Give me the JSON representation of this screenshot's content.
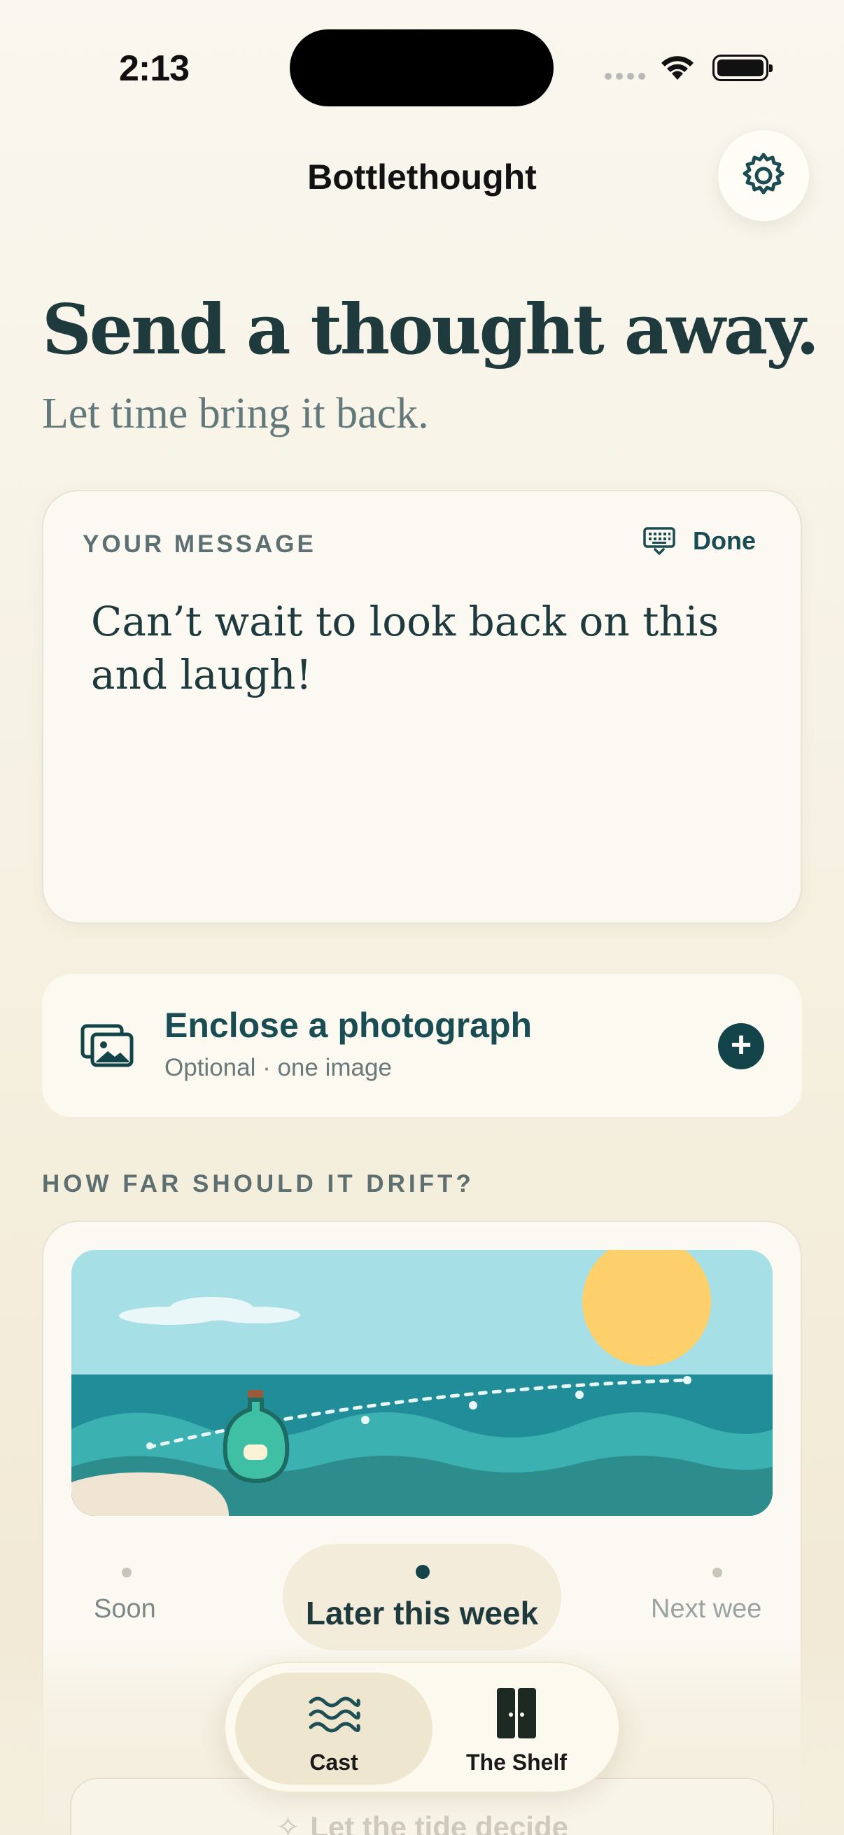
{
  "status_bar": {
    "time": "2:13"
  },
  "nav": {
    "title": "Bottlethought",
    "settings_icon": "gear-icon"
  },
  "hero": {
    "title": "Send a thought away.",
    "subtitle": "Let time bring it back."
  },
  "message_card": {
    "label": "YOUR MESSAGE",
    "done_label": "Done",
    "keyboard_icon": "keyboard-icon",
    "text": "Can’t wait to look back on this and laugh!"
  },
  "photo_card": {
    "title": "Enclose a photograph",
    "subtitle": "Optional · one image",
    "icon": "photos-icon",
    "add_icon": "plus-icon"
  },
  "drift": {
    "label": "HOW FAR SHOULD IT DRIFT?",
    "options": [
      "Soon",
      "Later this week",
      "Next wee"
    ],
    "selected": "Later this week"
  },
  "secondary_button": {
    "label": "Let the tide decide",
    "icon": "sparkle-icon"
  },
  "tab_bar": {
    "tabs": [
      {
        "label": "Cast",
        "icon": "waves-icon",
        "active": true
      },
      {
        "label": "The Shelf",
        "icon": "shelf-icon",
        "active": false
      }
    ]
  },
  "colors": {
    "accent": "#13444a",
    "text": "#1f3a3d",
    "sky": "#a7dfe6",
    "sea": "#218d99",
    "sun": "#fdd06c",
    "sand": "#efe5d2"
  }
}
